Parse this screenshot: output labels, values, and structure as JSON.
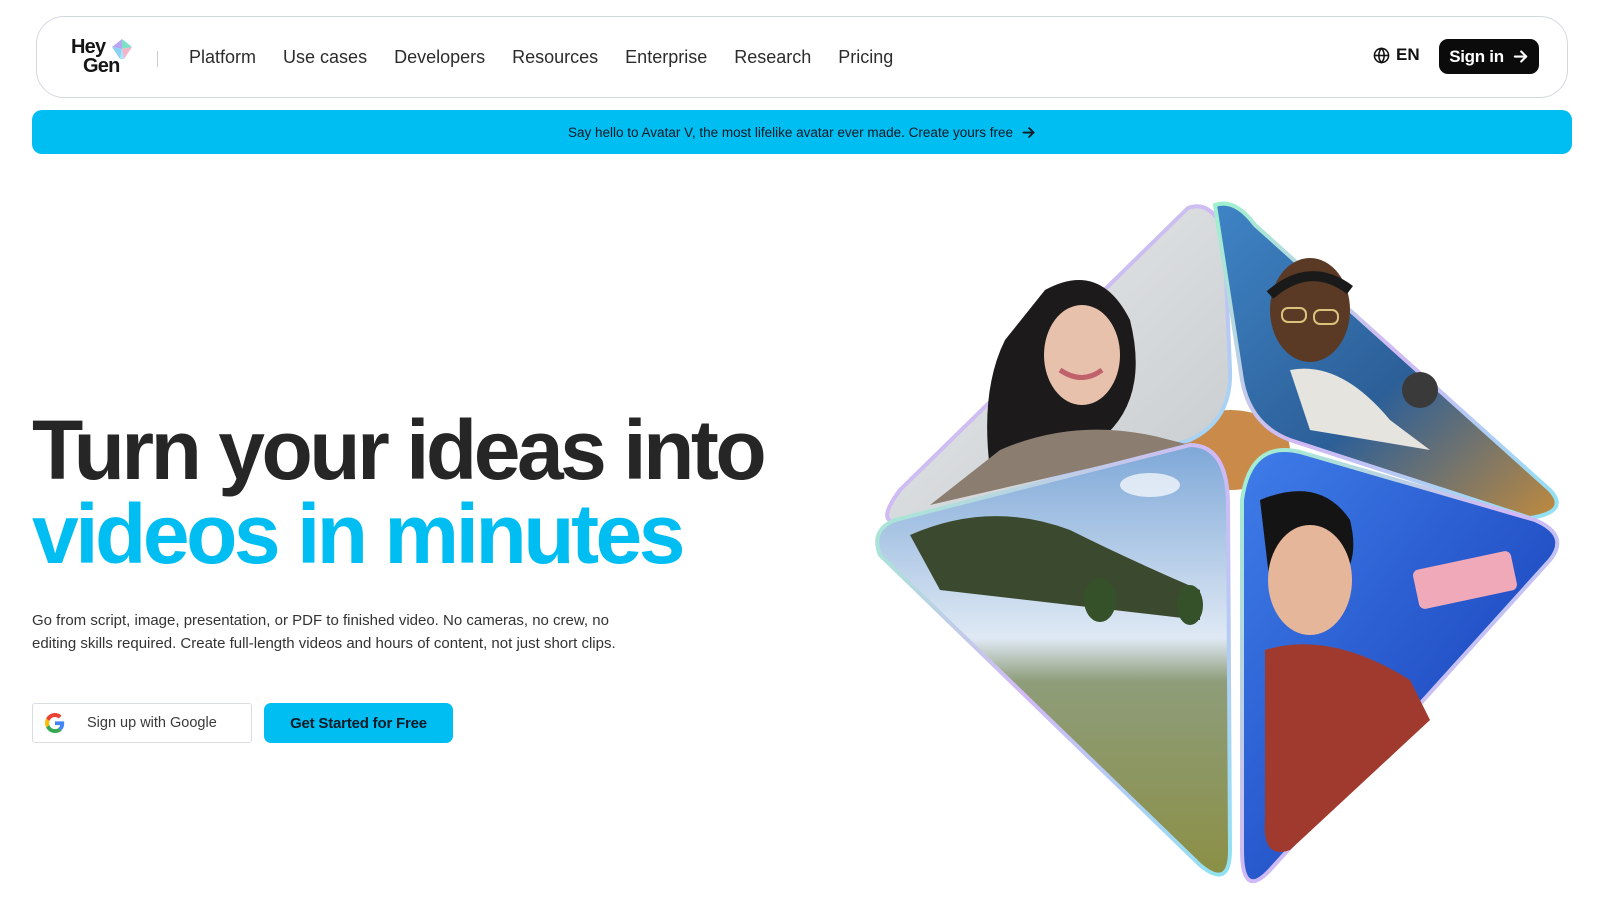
{
  "header": {
    "logo": {
      "line1": "Hey",
      "line2": "Gen"
    },
    "nav": [
      {
        "label": "Platform"
      },
      {
        "label": "Use cases"
      },
      {
        "label": "Developers"
      },
      {
        "label": "Resources"
      },
      {
        "label": "Enterprise"
      },
      {
        "label": "Research"
      },
      {
        "label": "Pricing"
      }
    ],
    "language": "EN",
    "language_icon": "globe-icon",
    "signin_label": "Sign in",
    "signin_icon": "arrow-right-icon"
  },
  "announcement": {
    "text": "Say hello to Avatar V, the most lifelike avatar ever made. Create yours free",
    "icon": "arrow-right-icon"
  },
  "hero": {
    "title_line1": "Turn your ideas into",
    "title_line2": "videos in minutes",
    "subtitle": "Go from script, image, presentation, or PDF to finished video. No cameras, no crew, no editing skills required. Create full-length videos and hours of content, not just short clips.",
    "google_button": "Sign up with Google",
    "google_icon": "google-icon",
    "cta_button": "Get Started for Free"
  },
  "colors": {
    "accent": "#00bdf2",
    "text_dark": "#262626",
    "button_dark": "#0b0b0b"
  }
}
